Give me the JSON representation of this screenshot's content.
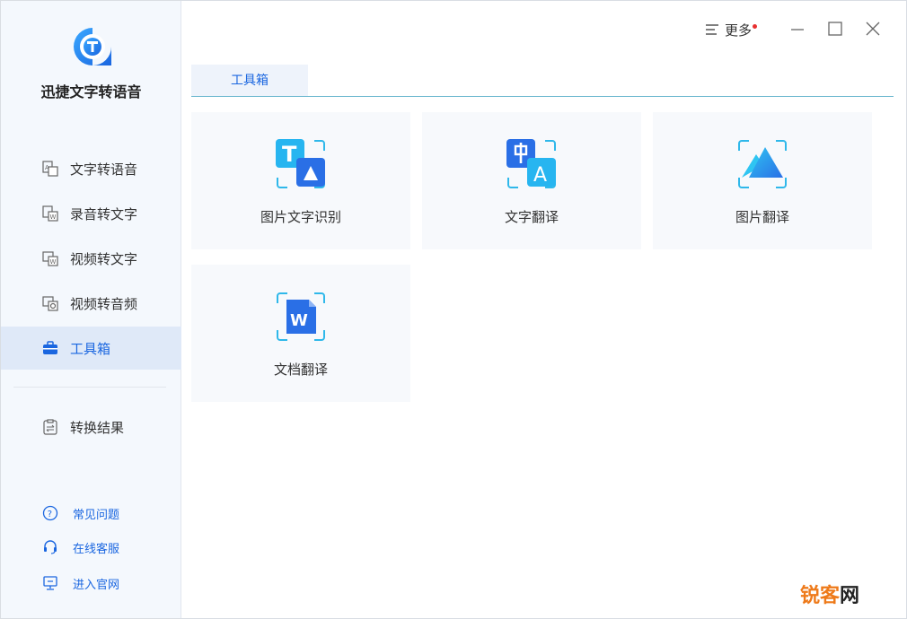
{
  "app": {
    "title": "迅捷文字转语音"
  },
  "sidebar": {
    "items": [
      {
        "label": "文字转语音",
        "icon": "text-to-speech-icon"
      },
      {
        "label": "录音转文字",
        "icon": "audio-to-text-icon"
      },
      {
        "label": "视频转文字",
        "icon": "video-to-text-icon"
      },
      {
        "label": "视频转音频",
        "icon": "video-to-audio-icon"
      },
      {
        "label": "工具箱",
        "icon": "toolbox-icon",
        "active": true
      },
      {
        "label": "转换结果",
        "icon": "results-icon"
      }
    ],
    "help": [
      {
        "label": "常见问题",
        "icon": "question-icon"
      },
      {
        "label": "在线客服",
        "icon": "headset-icon"
      },
      {
        "label": "进入官网",
        "icon": "monitor-icon"
      }
    ]
  },
  "titlebar": {
    "more_label": "更多"
  },
  "tabs": [
    {
      "label": "工具箱"
    }
  ],
  "tools": [
    {
      "label": "图片文字识别",
      "icon": "image-ocr-icon"
    },
    {
      "label": "文字翻译",
      "icon": "text-translate-icon"
    },
    {
      "label": "图片翻译",
      "icon": "image-translate-icon"
    },
    {
      "label": "文档翻译",
      "icon": "document-translate-icon"
    }
  ],
  "watermark": {
    "part1": "锐客",
    "part2": "网"
  },
  "colors": {
    "accent": "#1a66e0",
    "sidebar_bg": "#f4f8fd",
    "card_bg": "#f7f9fc",
    "badge": "#e83030"
  }
}
